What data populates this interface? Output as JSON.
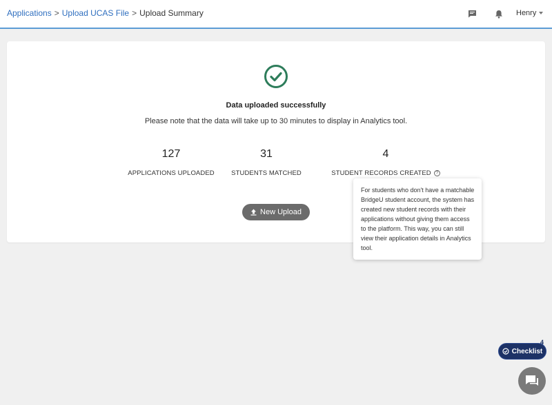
{
  "breadcrumb": {
    "items": [
      {
        "label": "Applications"
      },
      {
        "label": "Upload UCAS File"
      },
      {
        "label": "Upload Summary"
      }
    ],
    "separator": ">"
  },
  "header": {
    "icons": [
      "message-icon",
      "bell-icon"
    ],
    "user_name": "Henry"
  },
  "summary": {
    "title": "Data uploaded successfully",
    "note": "Please note that the data will take up to 30 minutes to display in Analytics tool.",
    "stats": [
      {
        "value": "127",
        "label": "APPLICATIONS UPLOADED"
      },
      {
        "value": "31",
        "label": "STUDENTS MATCHED"
      },
      {
        "value": "4",
        "label": "STUDENT RECORDS CREATED"
      }
    ],
    "new_upload_label": "New Upload",
    "tooltip_text": "For students who don't have a matchable BridgeU student account, the system has created new student records with their applications without giving them access to the platform. This way, you can still view their application details in Analytics tool."
  },
  "widgets": {
    "checklist_label": "Checklist",
    "checklist_badge": "4"
  },
  "colors": {
    "accent": "#2f6fbf",
    "success": "#2e7d5b",
    "checklist_bg": "#1d3266",
    "button_bg": "#6b6b6b"
  }
}
